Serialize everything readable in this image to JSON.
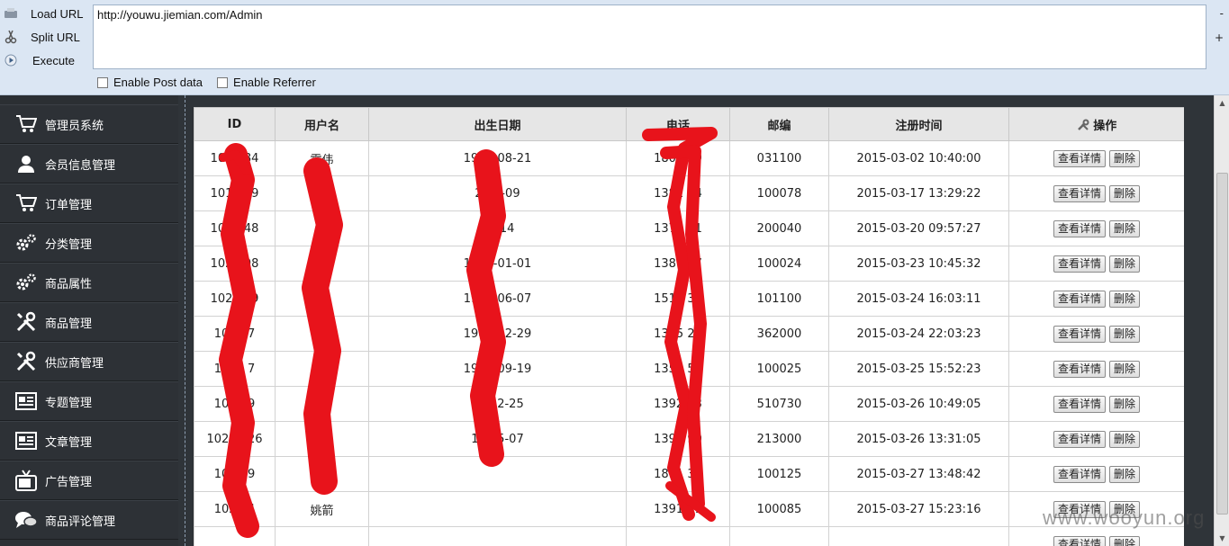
{
  "hackbar": {
    "actions": [
      {
        "label": "Load URL",
        "icon": "load-url-icon"
      },
      {
        "label": "Split URL",
        "icon": "split-url-icon"
      },
      {
        "label": "Execute",
        "icon": "execute-icon"
      }
    ],
    "url": "http://youwu.jiemian.com/Admin",
    "side_buttons": [
      "-",
      "+"
    ],
    "checkboxes": [
      {
        "label": "Enable Post data",
        "checked": false
      },
      {
        "label": "Enable Referrer",
        "checked": false
      }
    ]
  },
  "sidebar": {
    "items": [
      {
        "label": "管理员系统",
        "icon": "cart-icon"
      },
      {
        "label": "会员信息管理",
        "icon": "user-icon"
      },
      {
        "label": "订单管理",
        "icon": "cart-icon"
      },
      {
        "label": "分类管理",
        "icon": "gears-icon"
      },
      {
        "label": "商品属性",
        "icon": "gears-icon"
      },
      {
        "label": "商品管理",
        "icon": "tools-icon"
      },
      {
        "label": "供应商管理",
        "icon": "tools-icon"
      },
      {
        "label": "专题管理",
        "icon": "newspaper-icon"
      },
      {
        "label": "文章管理",
        "icon": "newspaper-icon"
      },
      {
        "label": "广告管理",
        "icon": "tv-icon"
      },
      {
        "label": "商品评论管理",
        "icon": "comment-icon"
      }
    ]
  },
  "table": {
    "columns": [
      "ID",
      "用户名",
      "出生日期",
      "电话",
      "邮编",
      "注册时间",
      "操作"
    ],
    "action_labels": {
      "detail": "查看详情",
      "delete": "删除"
    },
    "rows": [
      {
        "id": "101 684",
        "user": "霍伟",
        "birth": "1984-08-21",
        "phone": "1801 39",
        "zip": "031100",
        "reg": "2015-03-02 10:40:00"
      },
      {
        "id": "1019 29",
        "user": "",
        "birth": "2 10-09",
        "phone": "1381 94",
        "zip": "100078",
        "reg": "2015-03-17 13:29:22"
      },
      {
        "id": "1019 48",
        "user": "吴",
        "birth": "04-14",
        "phone": "1376 61",
        "zip": "200040",
        "reg": "2015-03-20 09:57:27"
      },
      {
        "id": "1020 98",
        "user": "杜",
        "birth": "1984-01-01",
        "phone": "1381 07",
        "zip": "100024",
        "reg": "2015-03-23 10:45:32"
      },
      {
        "id": "1020 19",
        "user": "",
        "birth": "1985-06-07",
        "phone": "1511 36",
        "zip": "101100",
        "reg": "2015-03-24 16:03:11"
      },
      {
        "id": "1020 7",
        "user": "",
        "birth": "1988-12-29",
        "phone": "1355 27",
        "zip": "362000",
        "reg": "2015-03-24 22:03:23"
      },
      {
        "id": "1020 7",
        "user": "",
        "birth": "1983-09-19",
        "phone": "1358 56",
        "zip": "100025",
        "reg": "2015-03-25 15:52:23"
      },
      {
        "id": "1020 9",
        "user": "",
        "birth": "198 2-25",
        "phone": "1392 03",
        "zip": "510730",
        "reg": "2015-03-26 10:49:05"
      },
      {
        "id": "1020 826",
        "user": "",
        "birth": "198 5-07",
        "phone": "1396 90",
        "zip": "213000",
        "reg": "2015-03-26 13:31:05"
      },
      {
        "id": "102 09",
        "user": "",
        "birth": "",
        "phone": "1891 31",
        "zip": "100125",
        "reg": "2015-03-27 13:48:42"
      },
      {
        "id": "102 54",
        "user": "姚箭",
        "birth": "",
        "phone": "1391 91",
        "zip": "100085",
        "reg": "2015-03-27 15:23:16"
      },
      {
        "id": "",
        "user": "",
        "birth": "",
        "phone": "",
        "zip": "",
        "reg": ""
      }
    ]
  },
  "watermark": "www.wooyun.org",
  "colors": {
    "sidebar_bg": "#2d3136",
    "hackbar_bg": "#dbe6f3",
    "header_bg": "#e6e6e6",
    "scribble_red": "#e8131b"
  }
}
